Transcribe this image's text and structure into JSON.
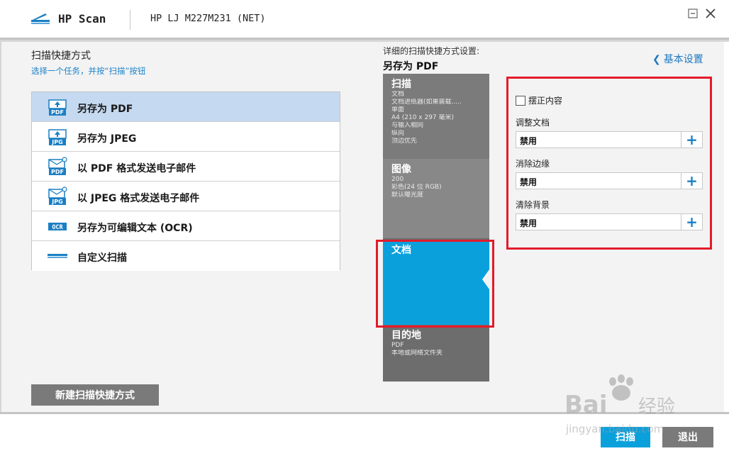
{
  "titlebar": {
    "app_title": "HP  Scan",
    "device_name": "HP LJ M227M231 (NET)",
    "minimize_icon": "minimize-icon",
    "close_icon": "close-icon"
  },
  "left": {
    "title": "扫描快捷方式",
    "subtitle": "选择一个任务，并按“扫描”按钮",
    "shortcuts": [
      {
        "label": "另存为 PDF",
        "icon": "pdf-folder-icon",
        "selected": true
      },
      {
        "label": "另存为 JPEG",
        "icon": "jpg-folder-icon",
        "selected": false
      },
      {
        "label": "以 PDF 格式发送电子邮件",
        "icon": "pdf-email-icon",
        "selected": false
      },
      {
        "label": "以 JPEG 格式发送电子邮件",
        "icon": "jpg-email-icon",
        "selected": false
      },
      {
        "label": "另存为可编辑文本 (OCR)",
        "icon": "ocr-icon",
        "selected": false
      },
      {
        "label": "自定义扫描",
        "icon": "scanner-icon",
        "selected": false
      }
    ],
    "new_shortcut_label": "新建扫描快捷方式"
  },
  "detail": {
    "heading": "详细的扫描快捷方式设置:",
    "name": "另存为 PDF",
    "basic_settings_label": "基本设置"
  },
  "steps": {
    "scan": {
      "title": "扫描",
      "lines": [
        "文档",
        "文档进纸器(如果装载.....",
        "单面",
        "A4 (210 x 297 毫米)",
        "与输入相同",
        "纵向",
        "顶边优先"
      ]
    },
    "image": {
      "title": "图像",
      "lines": [
        "200",
        "彩色(24 位 RGB)",
        "默认曝光度"
      ]
    },
    "document": {
      "title": "文档"
    },
    "destination": {
      "title": "目的地",
      "lines": [
        "PDF",
        "本地或网络文件夹"
      ]
    }
  },
  "settings": {
    "deskew_label": "摆正内容",
    "deskew_checked": false,
    "adjust_label": "调整文档",
    "adjust_value": "禁用",
    "edge_label": "消除边缘",
    "edge_value": "禁用",
    "bg_label": "清除背景",
    "bg_value": "禁用"
  },
  "footer": {
    "scan_label": "扫描",
    "exit_label": "退出"
  },
  "watermark": {
    "brand": "Bai",
    "brand_cn": "经验",
    "url": "jingyan.baidu.com"
  },
  "colors": {
    "accent": "#0aa0dc",
    "highlight": "#e21b2b",
    "selected_row": "#c5d9f0",
    "link": "#1e78c0"
  }
}
